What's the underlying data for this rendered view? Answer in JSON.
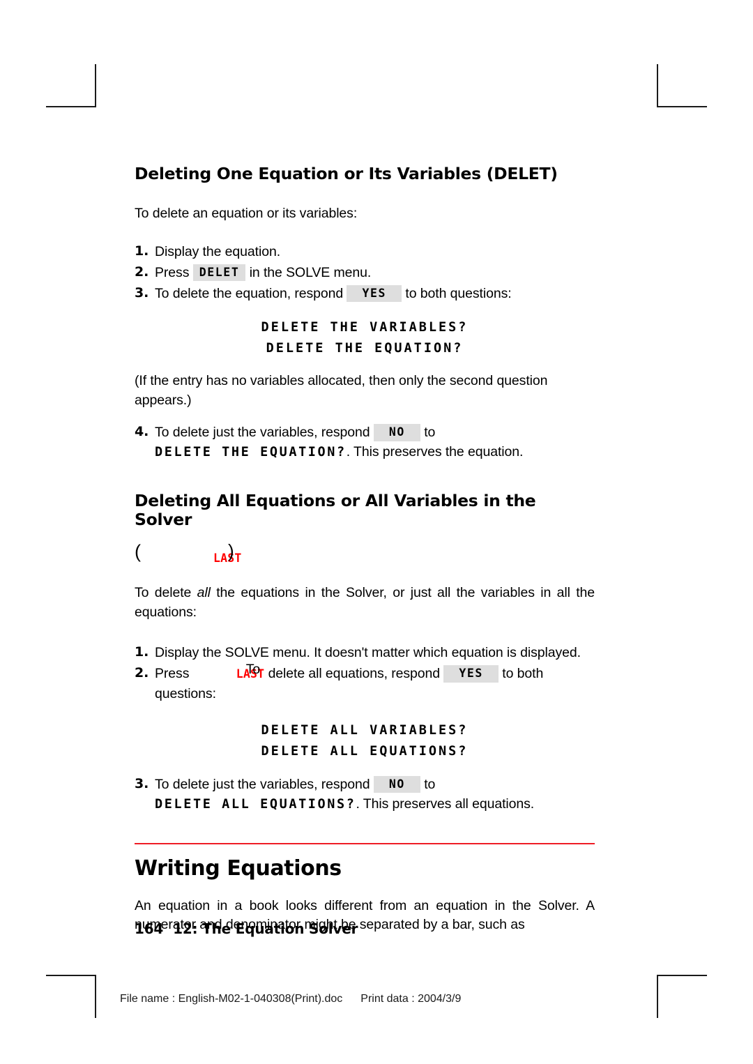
{
  "page": {
    "number": "164",
    "chapter_label": "12: The Equation Solver"
  },
  "print_meta": {
    "file_name_label": "File name : English-M02-1-040308(Print).doc",
    "print_date_label": "Print data : 2004/3/9"
  },
  "section_one": {
    "heading": "Deleting One Equation or Its Variables (DELET)",
    "intro": "To delete an equation or its variables:",
    "steps": [
      {
        "num": "1.",
        "text": "Display the equation."
      },
      {
        "num": "2.",
        "pre": "Press",
        "key": "DELET",
        "post": "in the SOLVE menu."
      },
      {
        "num": "3.",
        "pre": "To delete the equation, respond",
        "key": "YES",
        "post": "to both questions:"
      },
      {
        "num": "4.",
        "pre": "To delete just the variables, respond",
        "key": "NO",
        "post": "to",
        "lcd_tail": "DELETE THE EQUATION?",
        "tail_text": ". This preserves the equation."
      }
    ],
    "lcd_prompts": [
      "DELETE THE VARIABLES?",
      "DELETE THE EQUATION?"
    ],
    "note": "(If the entry has no variables allocated, then only the second question appears.)"
  },
  "section_two": {
    "heading": "Deleting All Equations or All Variables in the Solver",
    "key_line": {
      "paren_open": "(",
      "last_key": "LAST",
      "paren_close": ")"
    },
    "intro_before_italic": "To delete ",
    "intro_italic": "all",
    "intro_after_italic": " the equations in the Solver, or just all the variables in all the equations:",
    "steps": [
      {
        "num": "1.",
        "text": "Display the SOLVE menu. It doesn't matter which equation is displayed."
      },
      {
        "num": "2.",
        "pre": "Press",
        "last_key": "LAST",
        "overlap_text": "To",
        "mid": "delete all equations, respond",
        "key": "YES",
        "post": "to both questions:"
      },
      {
        "num": "3.",
        "pre": "To delete just the variables, respond",
        "key": "NO",
        "post": "to",
        "lcd_tail": "DELETE ALL EQUATIONS?",
        "tail_text": ". This preserves all equations."
      }
    ],
    "lcd_prompts": [
      "DELETE ALL VARIABLES?",
      "DELETE ALL EQUATIONS?"
    ]
  },
  "section_three": {
    "heading": "Writing Equations",
    "body": "An equation in a book looks different from an equation in the Solver. A numerator and denominator might be separated by a bar, such as"
  },
  "colors": {
    "rule_red": "#ee1c25",
    "last_red": "#ff0000",
    "key_background": "#dedede"
  }
}
